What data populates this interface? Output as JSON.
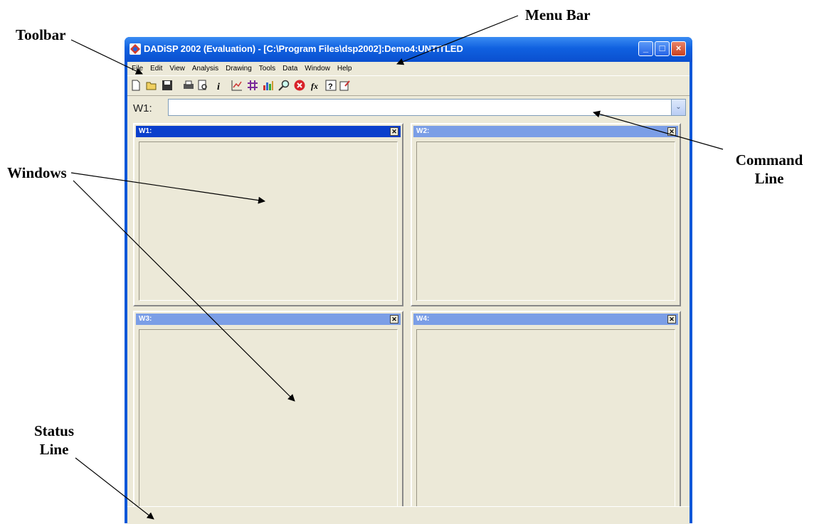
{
  "labels": {
    "menu_bar": "Menu Bar",
    "toolbar": "Toolbar",
    "windows": "Windows",
    "command_line": "Command Line",
    "status_line": "Status Line"
  },
  "app": {
    "title": "DADiSP 2002 (Evaluation) - [C:\\Program Files\\dsp2002]:Demo4:UNTITLED",
    "minimize_glyph": "_",
    "maximize_glyph": "□",
    "close_glyph": "×"
  },
  "menu": [
    "File",
    "Edit",
    "View",
    "Analysis",
    "Drawing",
    "Tools",
    "Data",
    "Window",
    "Help"
  ],
  "toolbar_icons": [
    "new-icon",
    "open-icon",
    "save-icon",
    "print-icon",
    "print-preview-icon",
    "info-icon",
    "chart-icon",
    "grid-icon",
    "bar-chart-icon",
    "zoom-icon",
    "stop-icon",
    "function-icon",
    "help-icon",
    "edit-icon"
  ],
  "command": {
    "label": "W1:",
    "value": "",
    "dropdown_glyph": "⌄"
  },
  "windows": [
    {
      "title": "W1:",
      "active": true
    },
    {
      "title": "W2:",
      "active": false
    },
    {
      "title": "W3:",
      "active": false
    },
    {
      "title": "W4:",
      "active": false
    }
  ],
  "colors": {
    "title_bar": "#0a57d8",
    "active_window_header": "#0a3fcc",
    "inactive_window_header": "#7b9ee6",
    "client_background": "#ece9d8"
  }
}
